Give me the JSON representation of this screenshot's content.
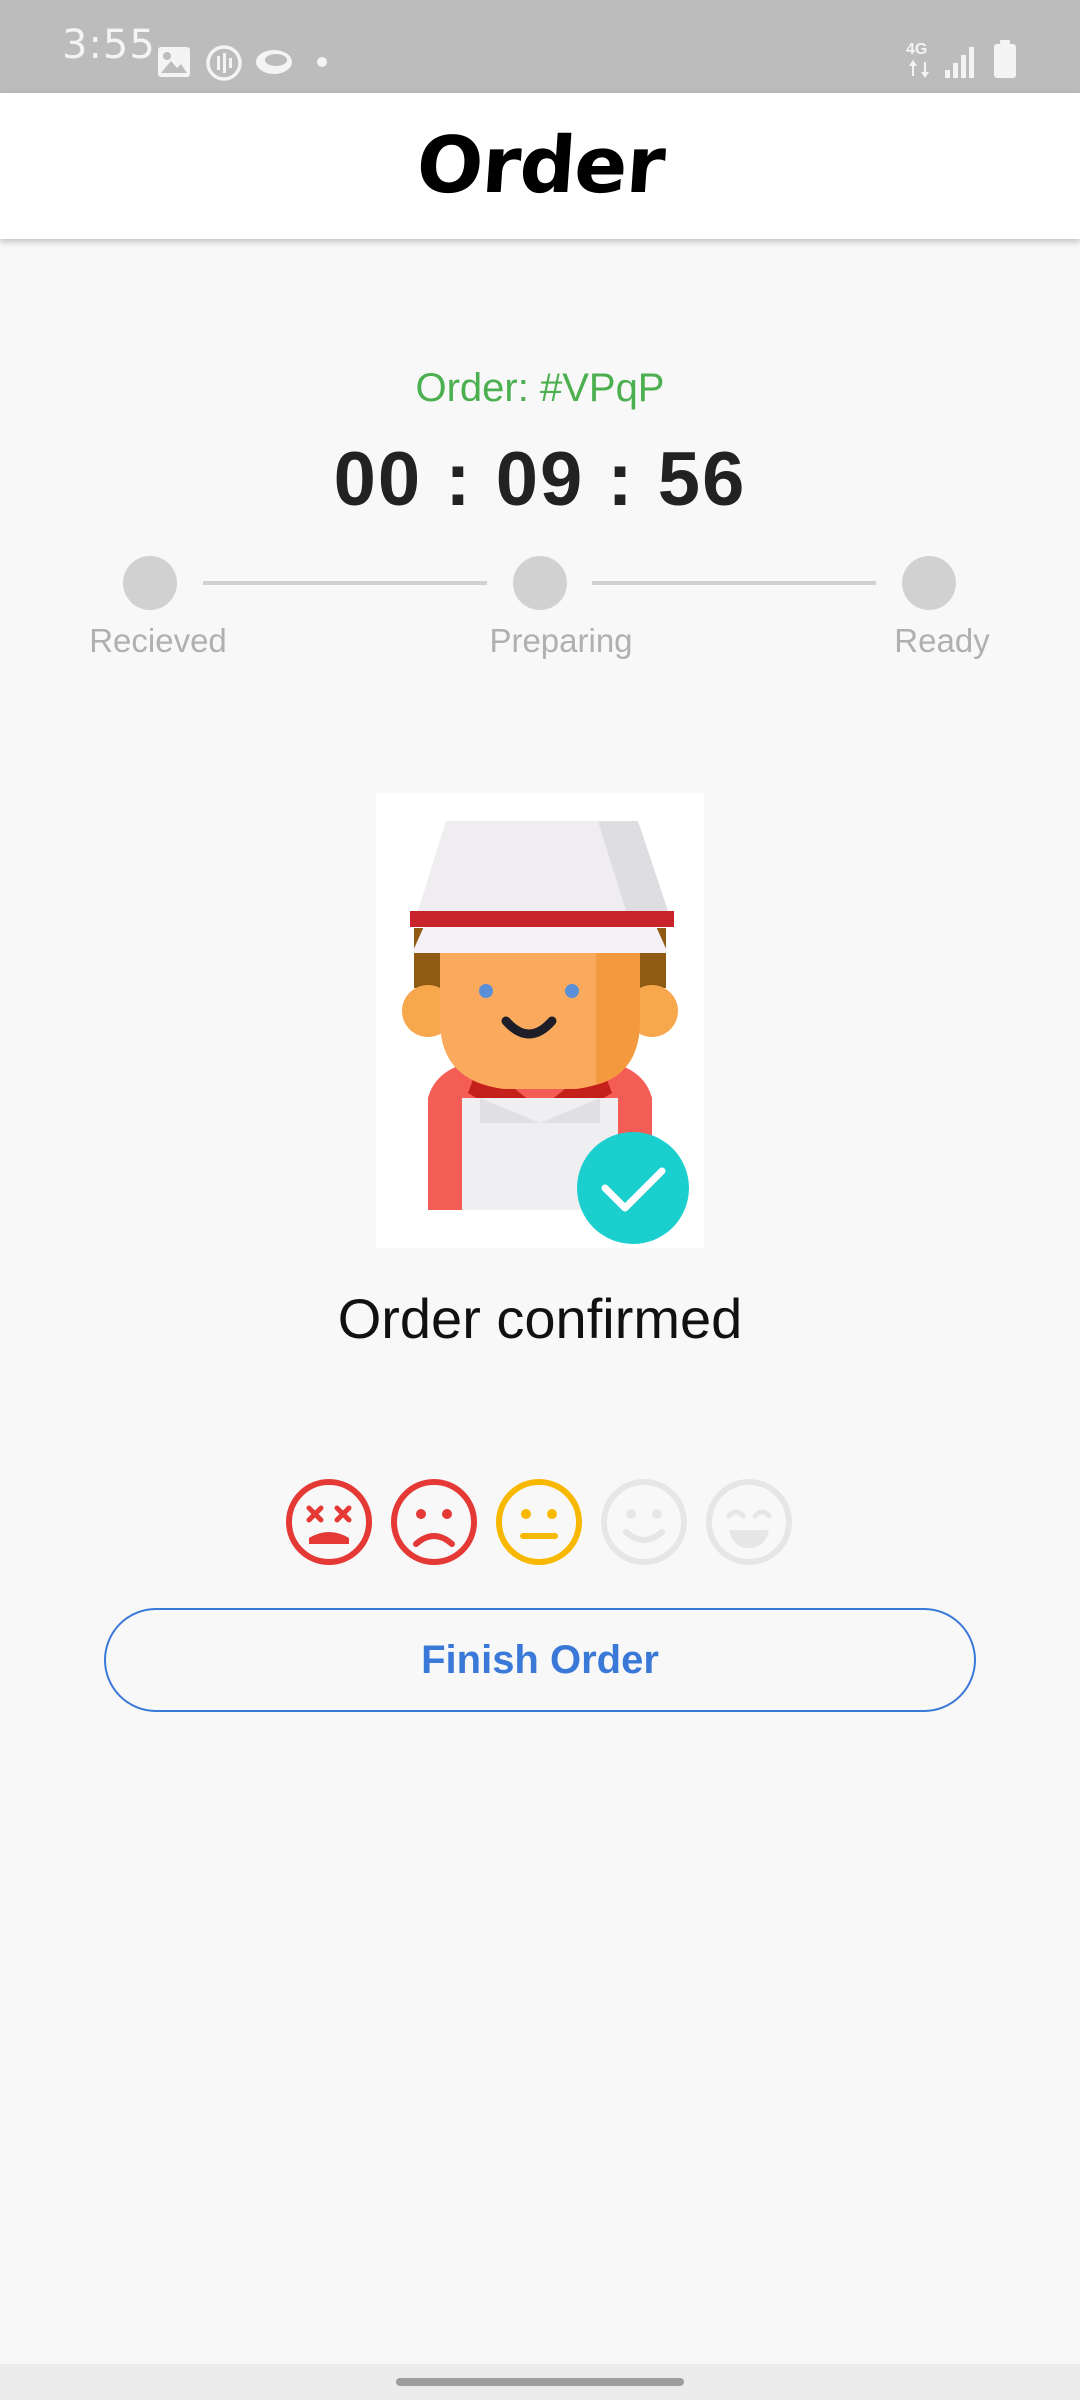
{
  "status_bar": {
    "time": "3:55",
    "network": "4G",
    "icons": [
      "gallery-icon",
      "voice-icon",
      "cloud-icon",
      "dot-icon",
      "signal-icon",
      "battery-icon"
    ]
  },
  "app_bar": {
    "title": "Order"
  },
  "order": {
    "number_label": "Order: #VPqP",
    "timer": "00 : 09 : 56",
    "status_message": "Order confirmed",
    "number_color": "#4caf50"
  },
  "progress": {
    "steps": [
      {
        "label": "Recieved"
      },
      {
        "label": "Preparing"
      },
      {
        "label": "Ready"
      }
    ],
    "inactive_color": "#d1d1d1"
  },
  "rating": {
    "options": [
      "very-bad",
      "bad",
      "neutral",
      "good",
      "very-good"
    ],
    "selected_level": 3,
    "colors": {
      "very_bad": "#e53935",
      "bad": "#e53935",
      "neutral": "#f9b800",
      "inactive": "#e6e6e6"
    }
  },
  "actions": {
    "finish_label": "Finish Order",
    "accent_color": "#3b79d8"
  },
  "illustration": {
    "icon": "chef-icon",
    "badge_icon": "checkmark-icon",
    "badge_color": "#1ccfcf"
  }
}
